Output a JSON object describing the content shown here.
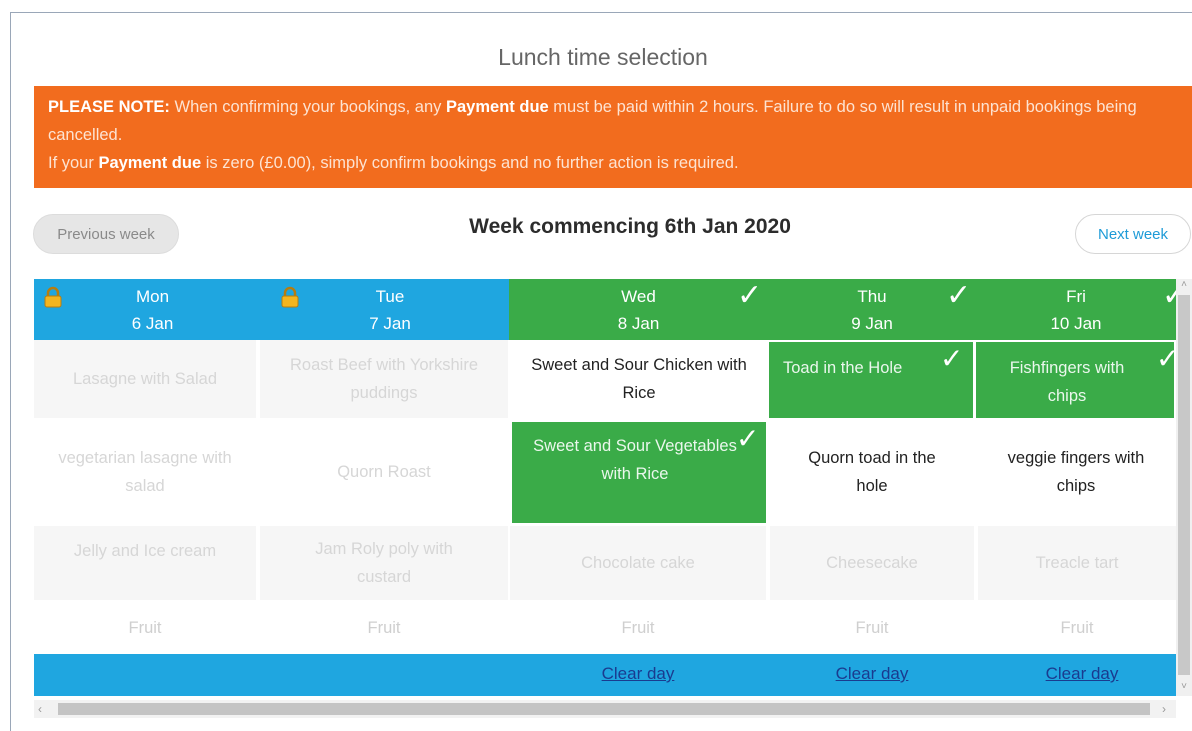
{
  "page_title": "Lunch time selection",
  "notice": {
    "line1_strong": "PLEASE NOTE:",
    "line1_text_a": " When confirming your bookings, any ",
    "line1_payment": "Payment due",
    "line1_text_b": " must be paid within 2 hours. Failure to do so will result in unpaid bookings being cancelled.",
    "line2_text_a": "If your ",
    "line2_payment": "Payment due",
    "line2_text_b": " is zero (£0.00), simply confirm bookings and no further action is required."
  },
  "nav": {
    "previous_label": "Previous week",
    "week_title": "Week commencing 6th Jan 2020",
    "next_label": "Next week"
  },
  "days": [
    {
      "day": "Mon",
      "date": "6 Jan",
      "locked": true,
      "selected": false
    },
    {
      "day": "Tue",
      "date": "7 Jan",
      "locked": true,
      "selected": false
    },
    {
      "day": "Wed",
      "date": "8 Jan",
      "locked": false,
      "selected": true
    },
    {
      "day": "Thu",
      "date": "9 Jan",
      "locked": false,
      "selected": true
    },
    {
      "day": "Fri",
      "date": "10 Jan",
      "locked": false,
      "selected": true
    }
  ],
  "menu": {
    "mains": [
      "Lasagne with Salad",
      "Roast Beef with Yorkshire puddings",
      "Sweet and Sour Chicken with Rice",
      "Toad in the Hole",
      "Fishfingers with chips"
    ],
    "vegetarian": [
      "vegetarian lasagne with salad",
      "Quorn Roast",
      "Sweet and Sour Vegetables with Rice",
      "Quorn toad in the hole",
      "veggie fingers with chips"
    ],
    "desserts": [
      "Jelly and Ice cream",
      "Jam Roly poly with custard",
      "Chocolate cake",
      "Cheesecake",
      "Treacle tart"
    ],
    "fruit": [
      "Fruit",
      "Fruit",
      "Fruit",
      "Fruit",
      "Fruit"
    ]
  },
  "footer": {
    "clear_label": "Clear day"
  },
  "icons": {
    "lock": "lock-icon",
    "check": "check-icon"
  },
  "colors": {
    "notice": "#f26c1e",
    "header_blue": "#1fa6e0",
    "selected_green": "#3aab48",
    "link": "#1a3b8f"
  }
}
